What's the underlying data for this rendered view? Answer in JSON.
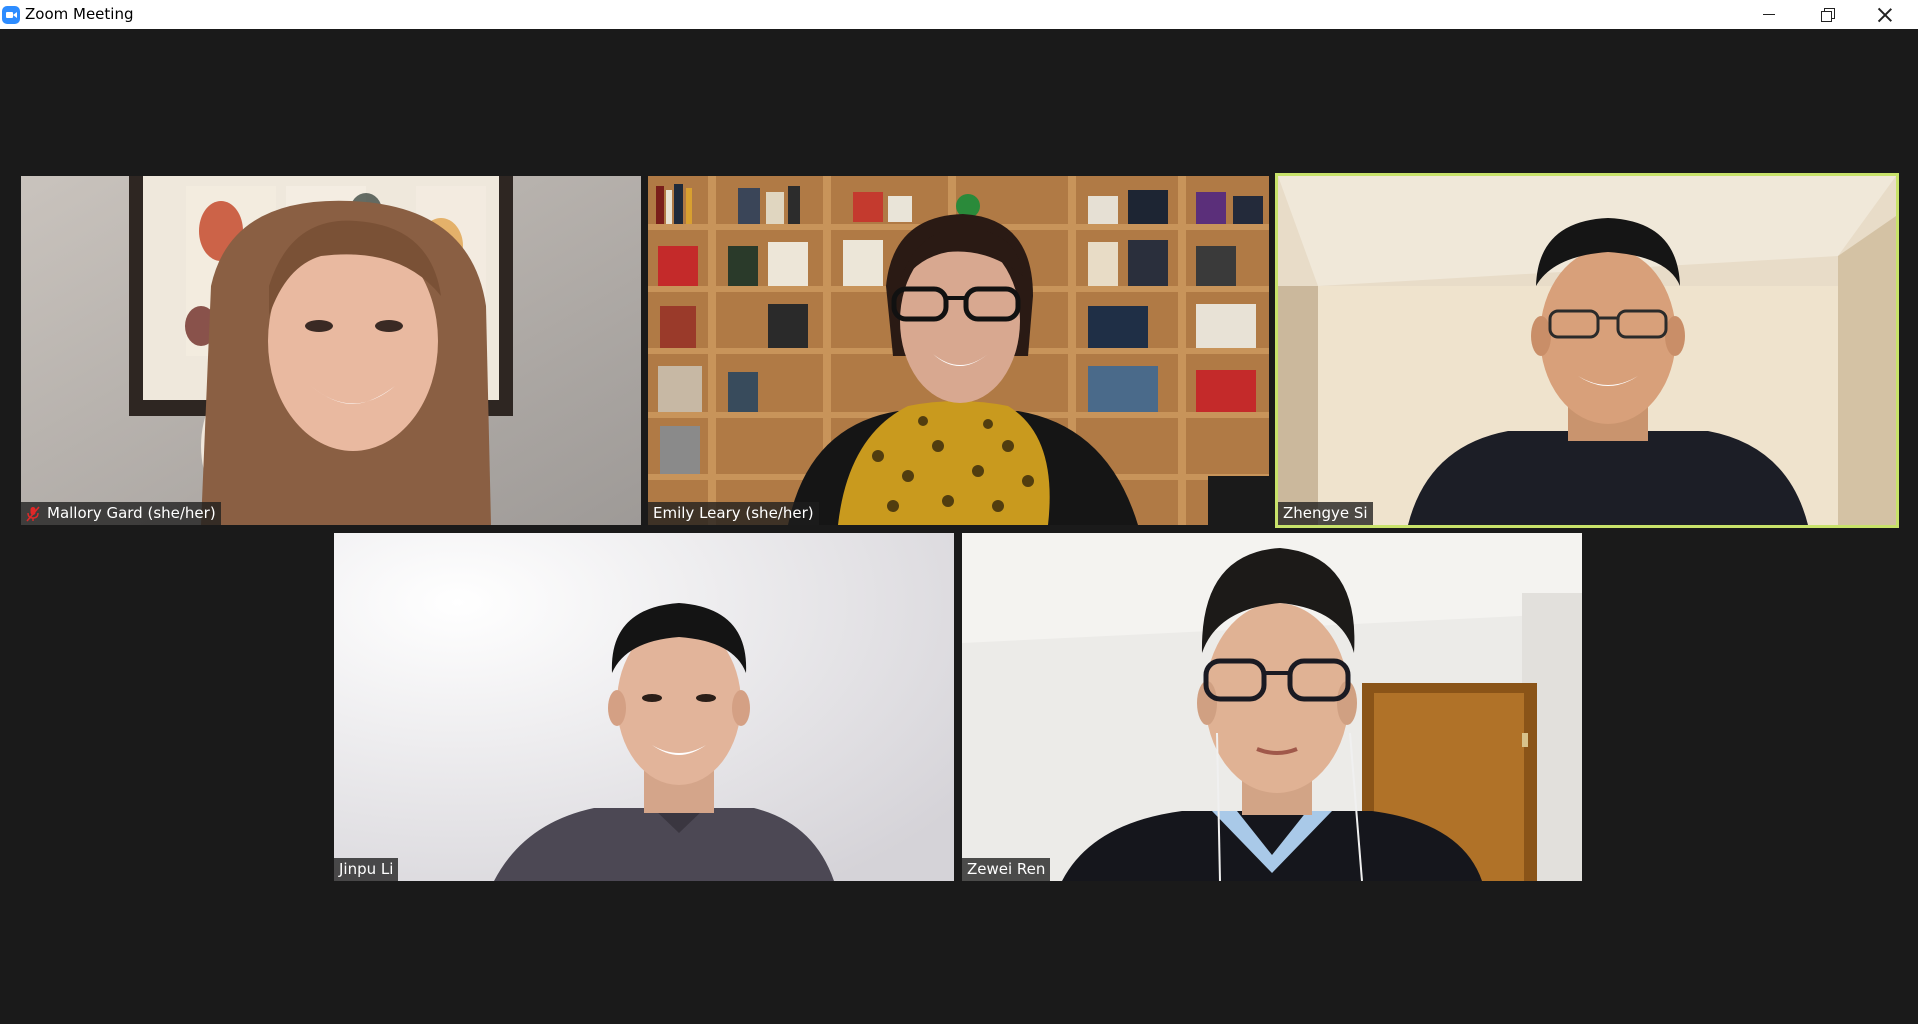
{
  "window": {
    "title": "Zoom Meeting",
    "controls": [
      "minimize-icon",
      "restore-icon",
      "close-icon"
    ]
  },
  "colors": {
    "background": "#1a1a1a",
    "titlebar": "#ffffff",
    "active_speaker_border": "#c8e26a",
    "muted_icon": "#e02828",
    "app_icon": "#2d8cff"
  },
  "participants": [
    {
      "name": "Mallory Gard (she/her)",
      "muted": true,
      "active_speaker": false
    },
    {
      "name": "Emily Leary (she/her)",
      "muted": false,
      "active_speaker": false
    },
    {
      "name": "Zhengye Si",
      "muted": false,
      "active_speaker": true
    },
    {
      "name": "Jinpu Li",
      "muted": false,
      "active_speaker": false
    },
    {
      "name": "Zewei Ren",
      "muted": false,
      "active_speaker": false
    }
  ]
}
